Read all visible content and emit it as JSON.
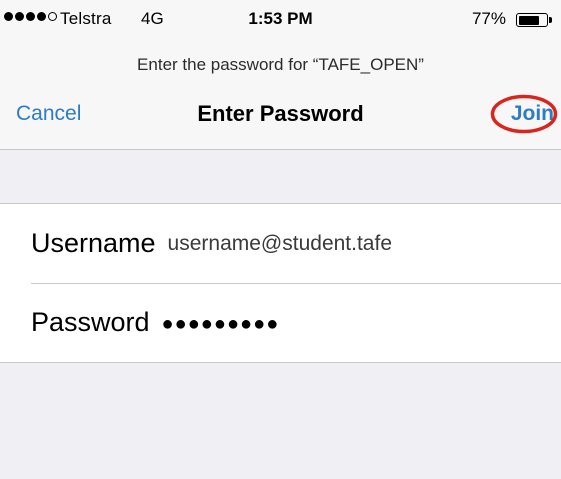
{
  "status_bar": {
    "signal_bars_filled": 4,
    "signal_bars_total": 5,
    "carrier": "Telstra",
    "network": "4G",
    "time": "1:53 PM",
    "battery_percent_label": "77%",
    "battery_level": 0.77
  },
  "header": {
    "prompt": "Enter the password for “TAFE_OPEN”",
    "cancel_label": "Cancel",
    "title": "Enter Password",
    "join_label": "Join",
    "join_highlight_color": "#d9251d"
  },
  "form": {
    "username_label": "Username",
    "username_value": "username@student.tafe",
    "password_label": "Password",
    "password_value": "●●●●●●●●●"
  },
  "colors": {
    "accent": "#2e7cc4",
    "background": "#efeff4",
    "separator": "#c8c7cc"
  }
}
